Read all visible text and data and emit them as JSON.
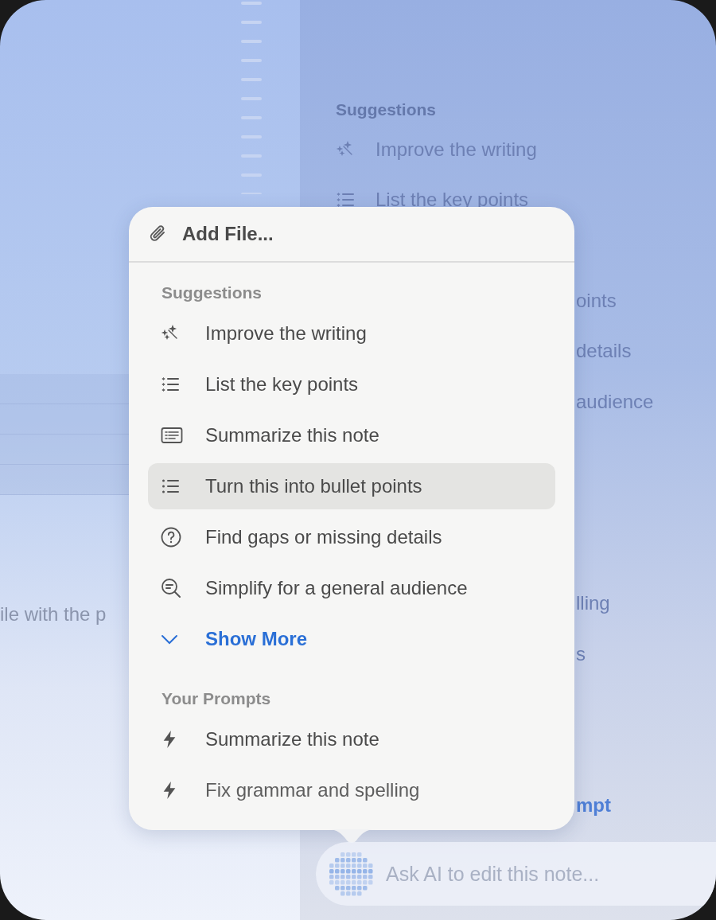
{
  "background": {
    "note_text": "ile with the p",
    "suggestions": {
      "heading": "Suggestions",
      "items": [
        {
          "label": "Improve the writing",
          "kind": "wand"
        },
        {
          "label": "List the key points",
          "kind": "starlist"
        }
      ]
    },
    "fragments": [
      {
        "text": "oints",
        "kind": "text"
      },
      {
        "text": "details",
        "kind": "text"
      },
      {
        "text": "audience",
        "kind": "text"
      },
      {
        "text": "lling",
        "kind": "text"
      },
      {
        "text": "s",
        "kind": "text"
      },
      {
        "text": "mpt",
        "kind": "link"
      }
    ]
  },
  "popover": {
    "add_file": "Add File...",
    "sections": [
      {
        "heading": "Suggestions",
        "items": [
          {
            "label": "Improve the writing",
            "kind": "wand",
            "selected": false
          },
          {
            "label": "List the key points",
            "kind": "starlist",
            "selected": false
          },
          {
            "label": "Summarize this note",
            "kind": "document",
            "selected": false
          },
          {
            "label": "Turn this into bullet points",
            "kind": "list",
            "selected": true
          },
          {
            "label": "Find gaps or missing details",
            "kind": "question",
            "selected": false
          },
          {
            "label": "Simplify for a general audience",
            "kind": "simplify",
            "selected": false
          }
        ],
        "show_more": "Show More"
      },
      {
        "heading": "Your Prompts",
        "items": [
          {
            "label": "Summarize this note",
            "kind": "bolt",
            "selected": false
          },
          {
            "label": "Fix grammar and spelling",
            "kind": "bolt",
            "selected": false
          }
        ]
      }
    ]
  },
  "ask_field": {
    "placeholder": "Ask AI to edit this note..."
  }
}
